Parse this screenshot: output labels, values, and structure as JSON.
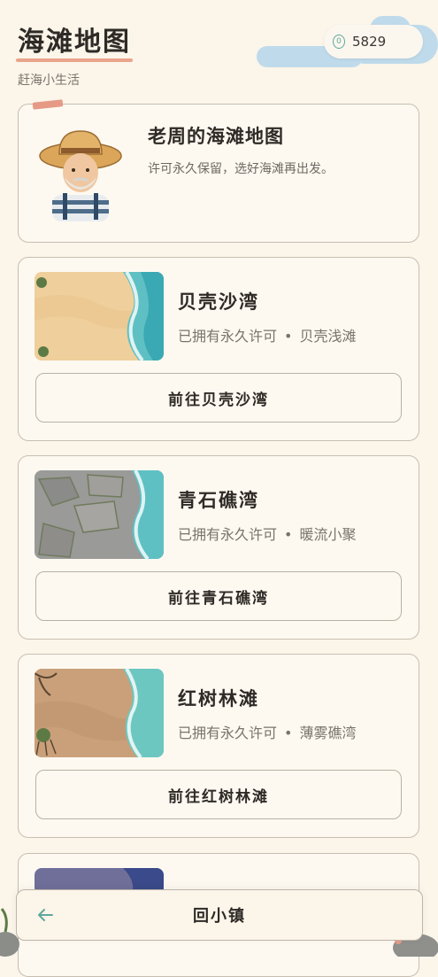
{
  "header": {
    "title": "海滩地图",
    "subtitle": "赶海小生活",
    "coin_icon": "coin-icon",
    "coin_value": "5829"
  },
  "intro": {
    "title": "老周的海滩地图",
    "description": "许可永久保留，选好海滩再出发。"
  },
  "beaches": [
    {
      "name": "贝壳沙湾",
      "status": "已拥有永久许可",
      "separator": "•",
      "feature": "贝壳浅滩",
      "button": "前往贝壳沙湾"
    },
    {
      "name": "青石礁湾",
      "status": "已拥有永久许可",
      "separator": "•",
      "feature": "暖流小聚",
      "button": "前往青石礁湾"
    },
    {
      "name": "红树林滩",
      "status": "已拥有永久许可",
      "separator": "•",
      "feature": "薄雾礁湾",
      "button": "前往红树林滩"
    }
  ],
  "bottom_bar": {
    "back_icon": "arrow-left-icon",
    "label": "回小镇"
  },
  "colors": {
    "background": "#fbf5ea",
    "accent_teal": "#5fa89c",
    "accent_coral": "#e5957a",
    "border": "#c7beb0"
  }
}
